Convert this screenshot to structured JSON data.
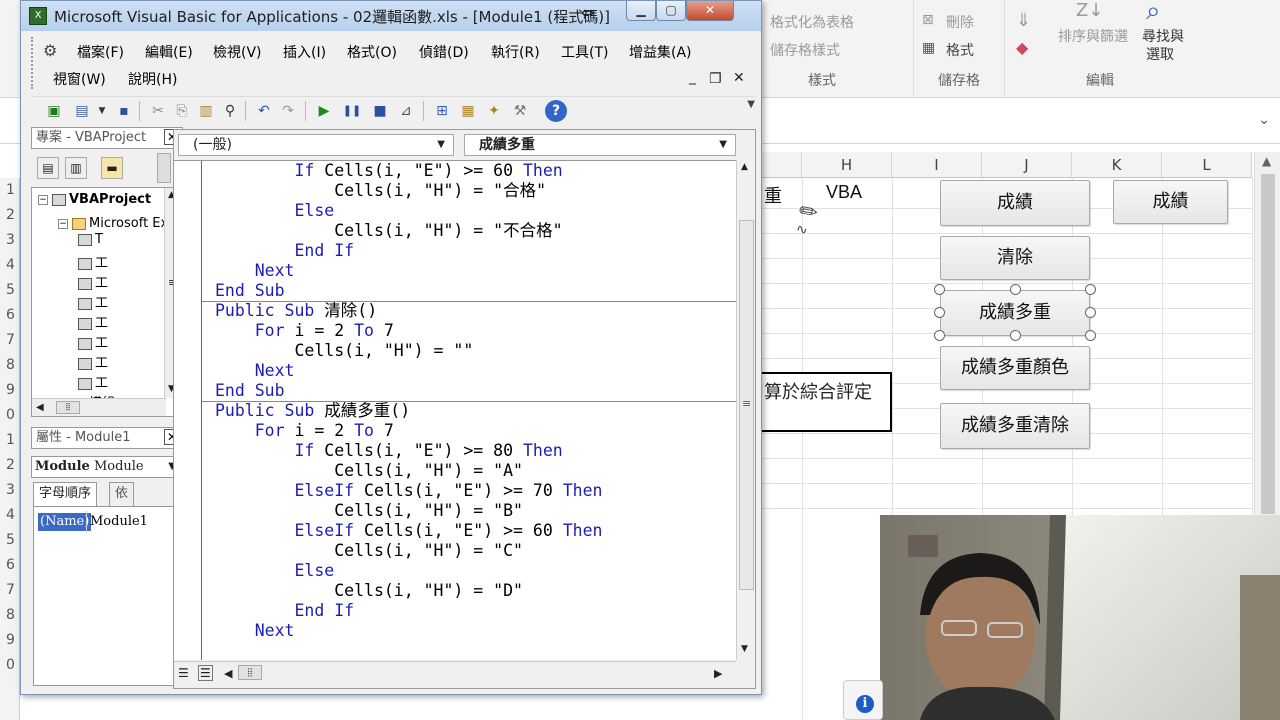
{
  "excel": {
    "ribbon": {
      "format_as_table": "格式化為表格",
      "cell_styles": "儲存格樣式",
      "delete": "刪除",
      "format": "格式",
      "sort_filter": "排序與篩選",
      "find_select_line1": "尋找與",
      "find_select_line2": "選取",
      "group_styles": "樣式",
      "group_cells": "儲存格",
      "group_edit": "編輯"
    },
    "columns": [
      "H",
      "I",
      "J",
      "K",
      "L"
    ],
    "cells": {
      "g_partial": "重",
      "h1": "VBA",
      "textbox_text": "算於綜合評定"
    },
    "buttons": {
      "grade": "成績",
      "grade_right": "成績",
      "clear": "清除",
      "grade_multi": "成績多重",
      "grade_multi_color": "成績多重顏色",
      "grade_multi_clear": "成績多重清除"
    },
    "row_numbers": [
      "1",
      "2",
      "3",
      "4",
      "5",
      "6",
      "7",
      "8",
      "9",
      "0",
      "1",
      "2",
      "3",
      "4",
      "5",
      "6",
      "7",
      "8",
      "9",
      "0"
    ]
  },
  "vbe": {
    "title": "Microsoft Visual Basic for Applications - 02邏輯函數.xls - [Module1 (程式碼)]",
    "menu": {
      "file": "檔案(F)",
      "edit": "編輯(E)",
      "view": "檢視(V)",
      "insert": "插入(I)",
      "format": "格式(O)",
      "debug": "偵錯(D)",
      "run": "執行(R)",
      "tools": "工具(T)",
      "addins": "增益集(A)",
      "window": "視窗(W)",
      "help": "說明(H)"
    },
    "project_pane": {
      "title": "專案 - VBAProject",
      "tree": [
        {
          "label": "VBAProject",
          "indent": 0,
          "kind": "project"
        },
        {
          "label": "Microsoft Excel 物件",
          "indent": 1,
          "kind": "folder"
        },
        {
          "label": "T",
          "indent": 2,
          "kind": "item"
        },
        {
          "label": "工",
          "indent": 2,
          "kind": "sheet"
        },
        {
          "label": "工",
          "indent": 2,
          "kind": "sheet"
        },
        {
          "label": "工",
          "indent": 2,
          "kind": "sheet"
        },
        {
          "label": "工",
          "indent": 2,
          "kind": "sheet"
        },
        {
          "label": "工",
          "indent": 2,
          "kind": "sheet"
        },
        {
          "label": "工",
          "indent": 2,
          "kind": "sheet"
        },
        {
          "label": "工",
          "indent": 2,
          "kind": "sheet"
        },
        {
          "label": "模組",
          "indent": 1,
          "kind": "folder"
        }
      ]
    },
    "properties_pane": {
      "title": "屬性 - Module1",
      "object_combo_bold": "Module",
      "object_combo_rest": " Module",
      "tab_alpha": "字母順序",
      "tab_cat": "依",
      "prop_name": "(Name)",
      "prop_value": "Module1"
    },
    "code": {
      "object_combo": "(一般)",
      "proc_combo": "成績多重",
      "lines": [
        "        If Cells(i, \"E\") >= 60 Then",
        "            Cells(i, \"H\") = \"合格\"",
        "        Else",
        "            Cells(i, \"H\") = \"不合格\"",
        "        End If",
        "    Next",
        "End Sub",
        "Public Sub 清除()",
        "    For i = 2 To 7",
        "        Cells(i, \"H\") = \"\"",
        "    Next",
        "End Sub",
        "Public Sub 成績多重()",
        "    For i = 2 To 7",
        "        If Cells(i, \"E\") >= 80 Then",
        "            Cells(i, \"H\") = \"A\"",
        "        ElseIf Cells(i, \"E\") >= 70 Then",
        "            Cells(i, \"H\") = \"B\"",
        "        ElseIf Cells(i, \"E\") >= 60 Then",
        "            Cells(i, \"H\") = \"C\"",
        "        Else",
        "            Cells(i, \"H\") = \"D\"",
        "        End If",
        "    Next"
      ],
      "procedure_separators_after_line": [
        6,
        11
      ]
    }
  },
  "colors": {
    "keyword": "#1c1cb8",
    "title_gradient_top": "#cfe0f4",
    "selected_prop": "#3b69c5"
  }
}
